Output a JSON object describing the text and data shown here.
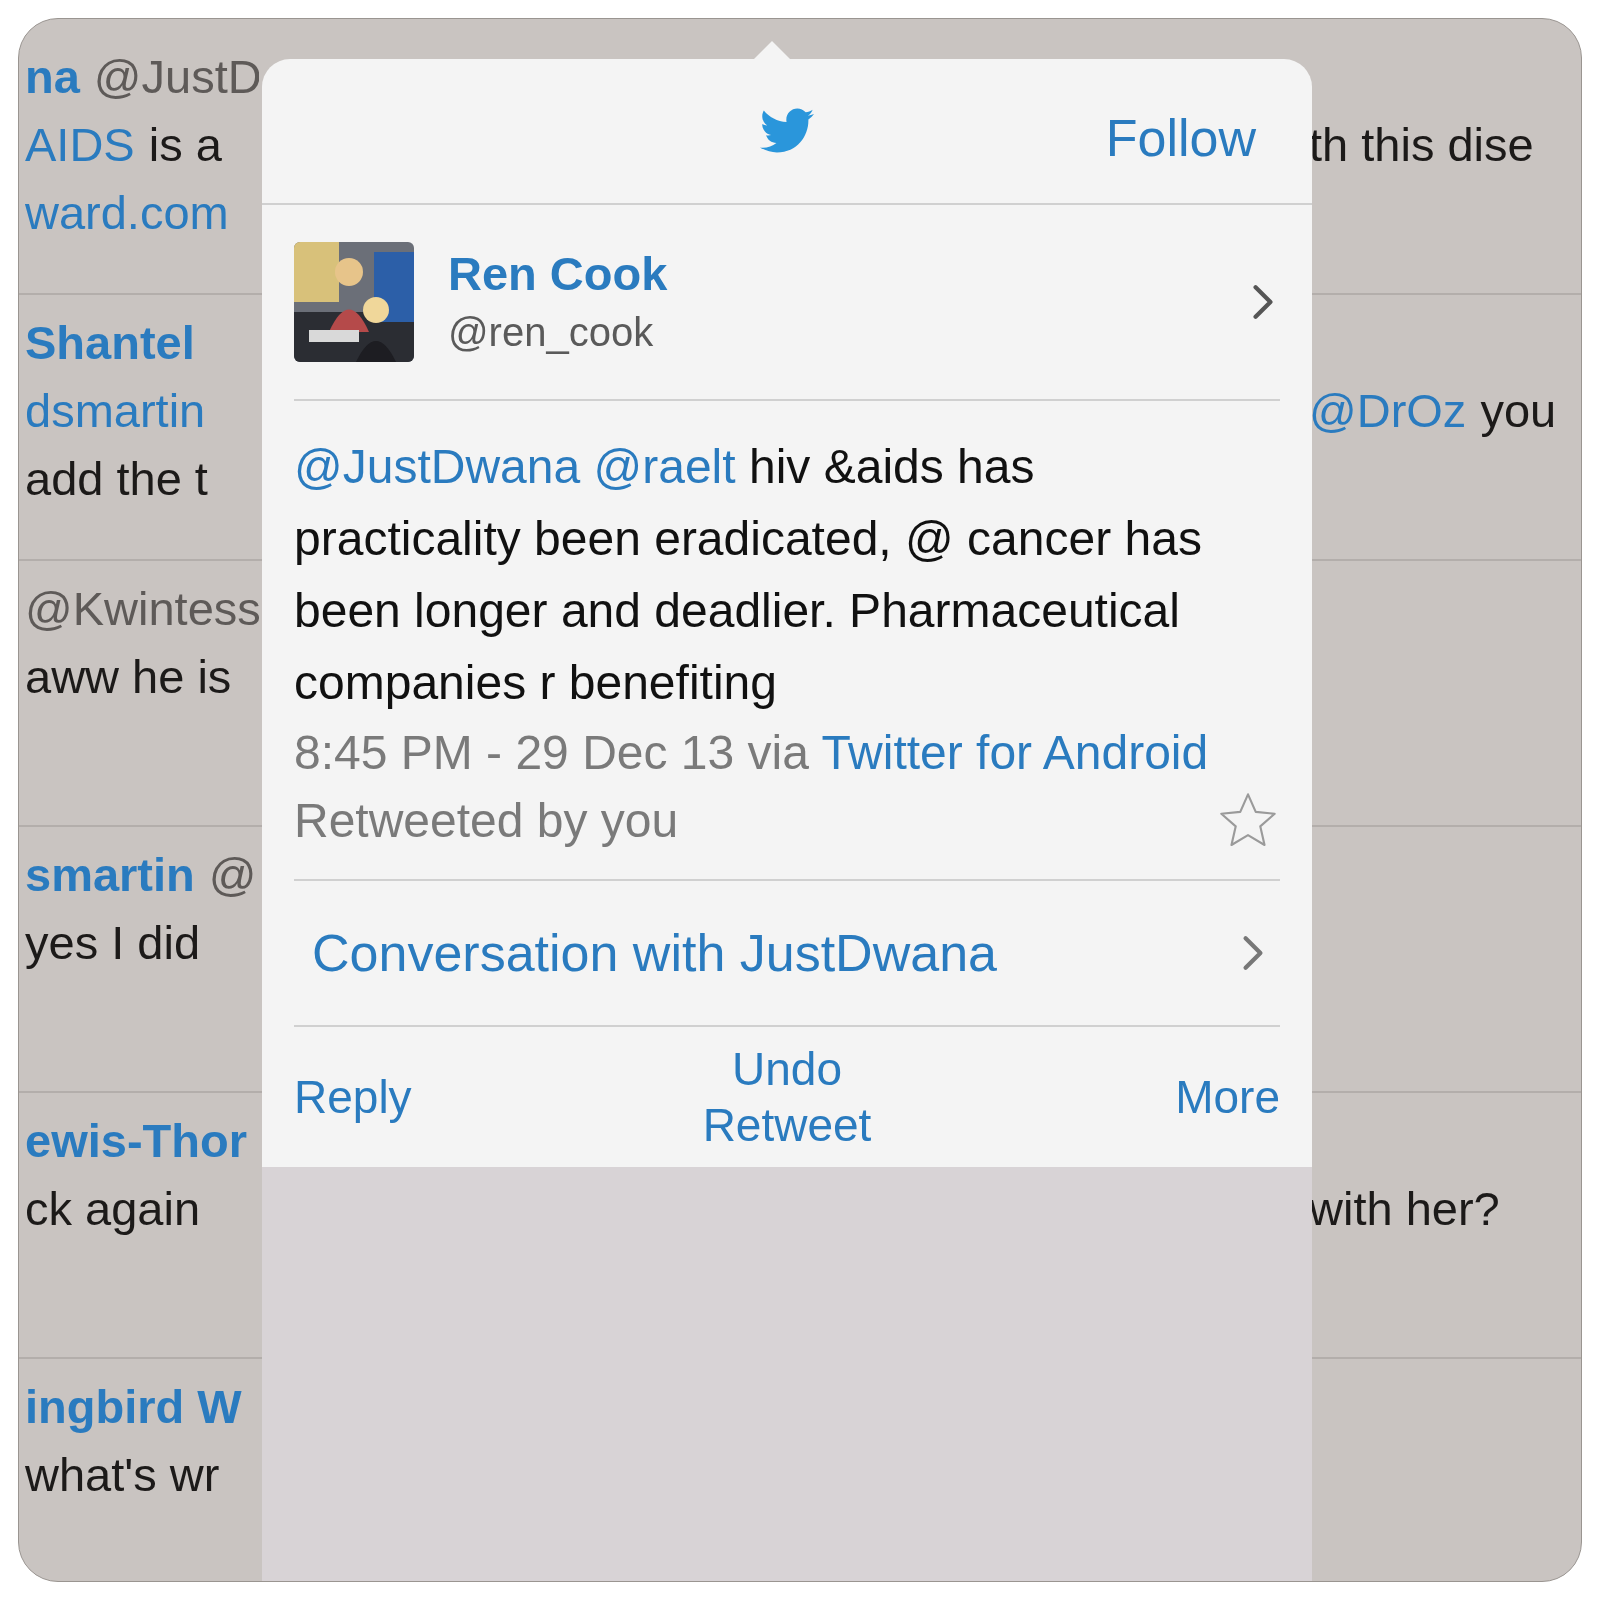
{
  "timeline": [
    {
      "left": [
        [
          {
            "kind": "name",
            "text": "na"
          },
          {
            "kind": "muted",
            "text": "@JustD"
          }
        ],
        [
          {
            "kind": "link",
            "text": "AIDS"
          },
          {
            "kind": "text",
            "text": "is a"
          }
        ],
        [
          {
            "kind": "link",
            "text": "ward.com"
          }
        ]
      ],
      "right": [
        {
          "kind": "text",
          "text": "th this dise"
        }
      ]
    },
    {
      "left": [
        [
          {
            "kind": "name",
            "text": "Shantel"
          }
        ],
        [
          {
            "kind": "link",
            "text": "dsmartin"
          }
        ],
        [
          {
            "kind": "text",
            "text": "add the t"
          }
        ]
      ],
      "right": [
        {
          "kind": "link",
          "text": "@DrOz"
        },
        {
          "kind": "text",
          "text": "you"
        }
      ]
    },
    {
      "left": [
        [
          {
            "kind": "muted",
            "text": "@Kwintess"
          }
        ],
        [
          {
            "kind": "text",
            "text": "aww he is"
          }
        ]
      ]
    },
    {
      "left": [
        [
          {
            "kind": "name",
            "text": "smartin"
          },
          {
            "kind": "muted",
            "text": "@"
          }
        ],
        [
          {
            "kind": "text",
            "text": "yes I did"
          }
        ]
      ]
    },
    {
      "left": [
        [
          {
            "kind": "name",
            "text": "ewis-Thor"
          }
        ],
        [
          {
            "kind": "text",
            "text": "ck again"
          }
        ]
      ],
      "right": [
        {
          "kind": "text",
          "text": "with her?"
        }
      ]
    },
    {
      "left": [
        [
          {
            "kind": "name",
            "text": "ingbird W"
          }
        ],
        [
          {
            "kind": "text",
            "text": "what's wr"
          }
        ]
      ]
    }
  ],
  "popover": {
    "follow": "Follow",
    "user": {
      "name": "Ren Cook",
      "handle": "@ren_cook"
    },
    "tweet": [
      {
        "kind": "mention",
        "text": "@JustDwana"
      },
      {
        "kind": "mention",
        "text": "@raelt"
      },
      {
        "kind": "text",
        "text": "hiv &aids has practicality been eradicated, @ cancer has been longer and deadlier. Pharmaceutical companies r benefiting"
      }
    ],
    "time": "8:45 PM - 29 Dec 13 via",
    "source": "Twitter for Android",
    "retweet_note": "Retweeted by you",
    "favorited": false,
    "conversation": "Conversation with JustDwana",
    "actions": [
      "Reply",
      "Undo Retweet",
      "More"
    ]
  }
}
